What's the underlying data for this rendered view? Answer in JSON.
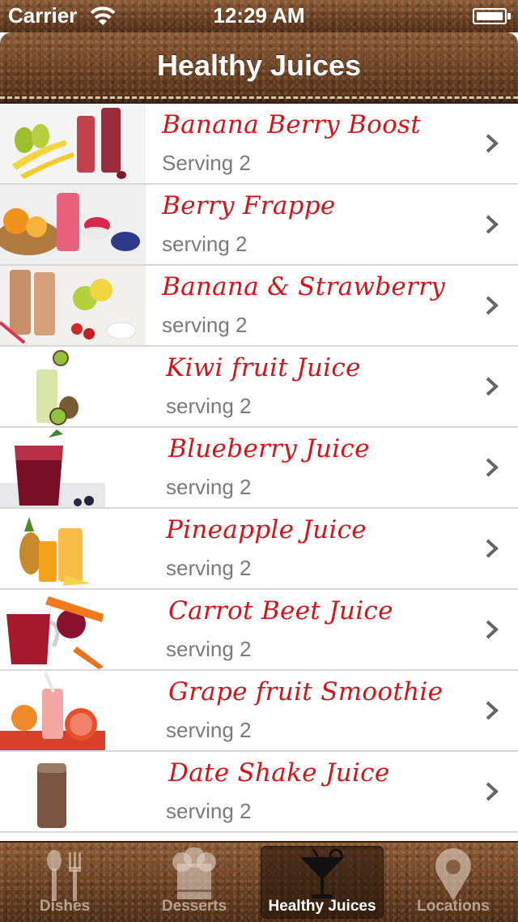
{
  "status_bar": {
    "carrier": "Carrier",
    "time": "12:29 AM"
  },
  "navbar": {
    "title": "Healthy Juices"
  },
  "items": [
    {
      "name": "Banana Berry Boost",
      "serving": "Serving 2"
    },
    {
      "name": "Berry Frappe",
      "serving": "serving 2"
    },
    {
      "name": "Banana & Strawberry",
      "serving": "serving 2"
    },
    {
      "name": "Kiwi fruit Juice",
      "serving": "serving 2"
    },
    {
      "name": "Blueberry Juice",
      "serving": "serving 2"
    },
    {
      "name": "Pineapple Juice",
      "serving": "serving 2"
    },
    {
      "name": "Carrot Beet Juice",
      "serving": "serving 2"
    },
    {
      "name": "Grape fruit Smoothie",
      "serving": "serving 2"
    },
    {
      "name": "Date Shake Juice",
      "serving": "serving 2"
    }
  ],
  "tabs": [
    {
      "label": "Dishes",
      "icon": "fork-spoon-icon",
      "selected": false
    },
    {
      "label": "Desserts",
      "icon": "chef-hat-icon",
      "selected": false
    },
    {
      "label": "Healthy Juices",
      "icon": "cocktail-glass-icon",
      "selected": true
    },
    {
      "label": "Locations",
      "icon": "map-pin-icon",
      "selected": false
    }
  ],
  "colors": {
    "item_title": "#d4141a",
    "serving_text": "#7a7a7a",
    "leather": "#6e4526"
  }
}
